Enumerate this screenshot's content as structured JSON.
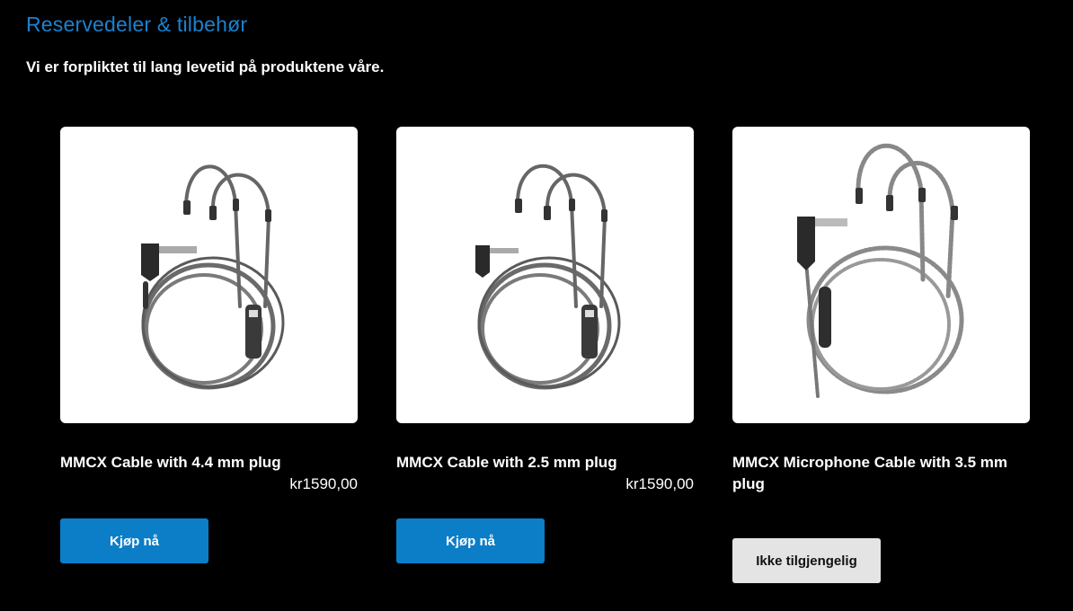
{
  "section": {
    "title": "Reservedeler & tilbehør",
    "subtitle": "Vi er forpliktet til lang levetid på produktene våre."
  },
  "products": [
    {
      "name": "MMCX Cable with 4.4 mm plug",
      "price": "kr1590,00",
      "button_label": "Kjøp nå",
      "image_icon": "mmcx-cable-4-4mm-image"
    },
    {
      "name": "MMCX Cable with 2.5 mm plug",
      "price": "kr1590,00",
      "button_label": "Kjøp nå",
      "image_icon": "mmcx-cable-2-5mm-image"
    },
    {
      "name": "MMCX Microphone Cable with 3.5 mm plug",
      "price": "",
      "button_label": "Ikke tilgjengelig",
      "image_icon": "mmcx-mic-cable-3-5mm-image"
    }
  ],
  "colors": {
    "background": "#000000",
    "title_blue": "#1a82cf",
    "button_blue": "#0b7ec7",
    "button_disabled": "#e4e4e4"
  }
}
